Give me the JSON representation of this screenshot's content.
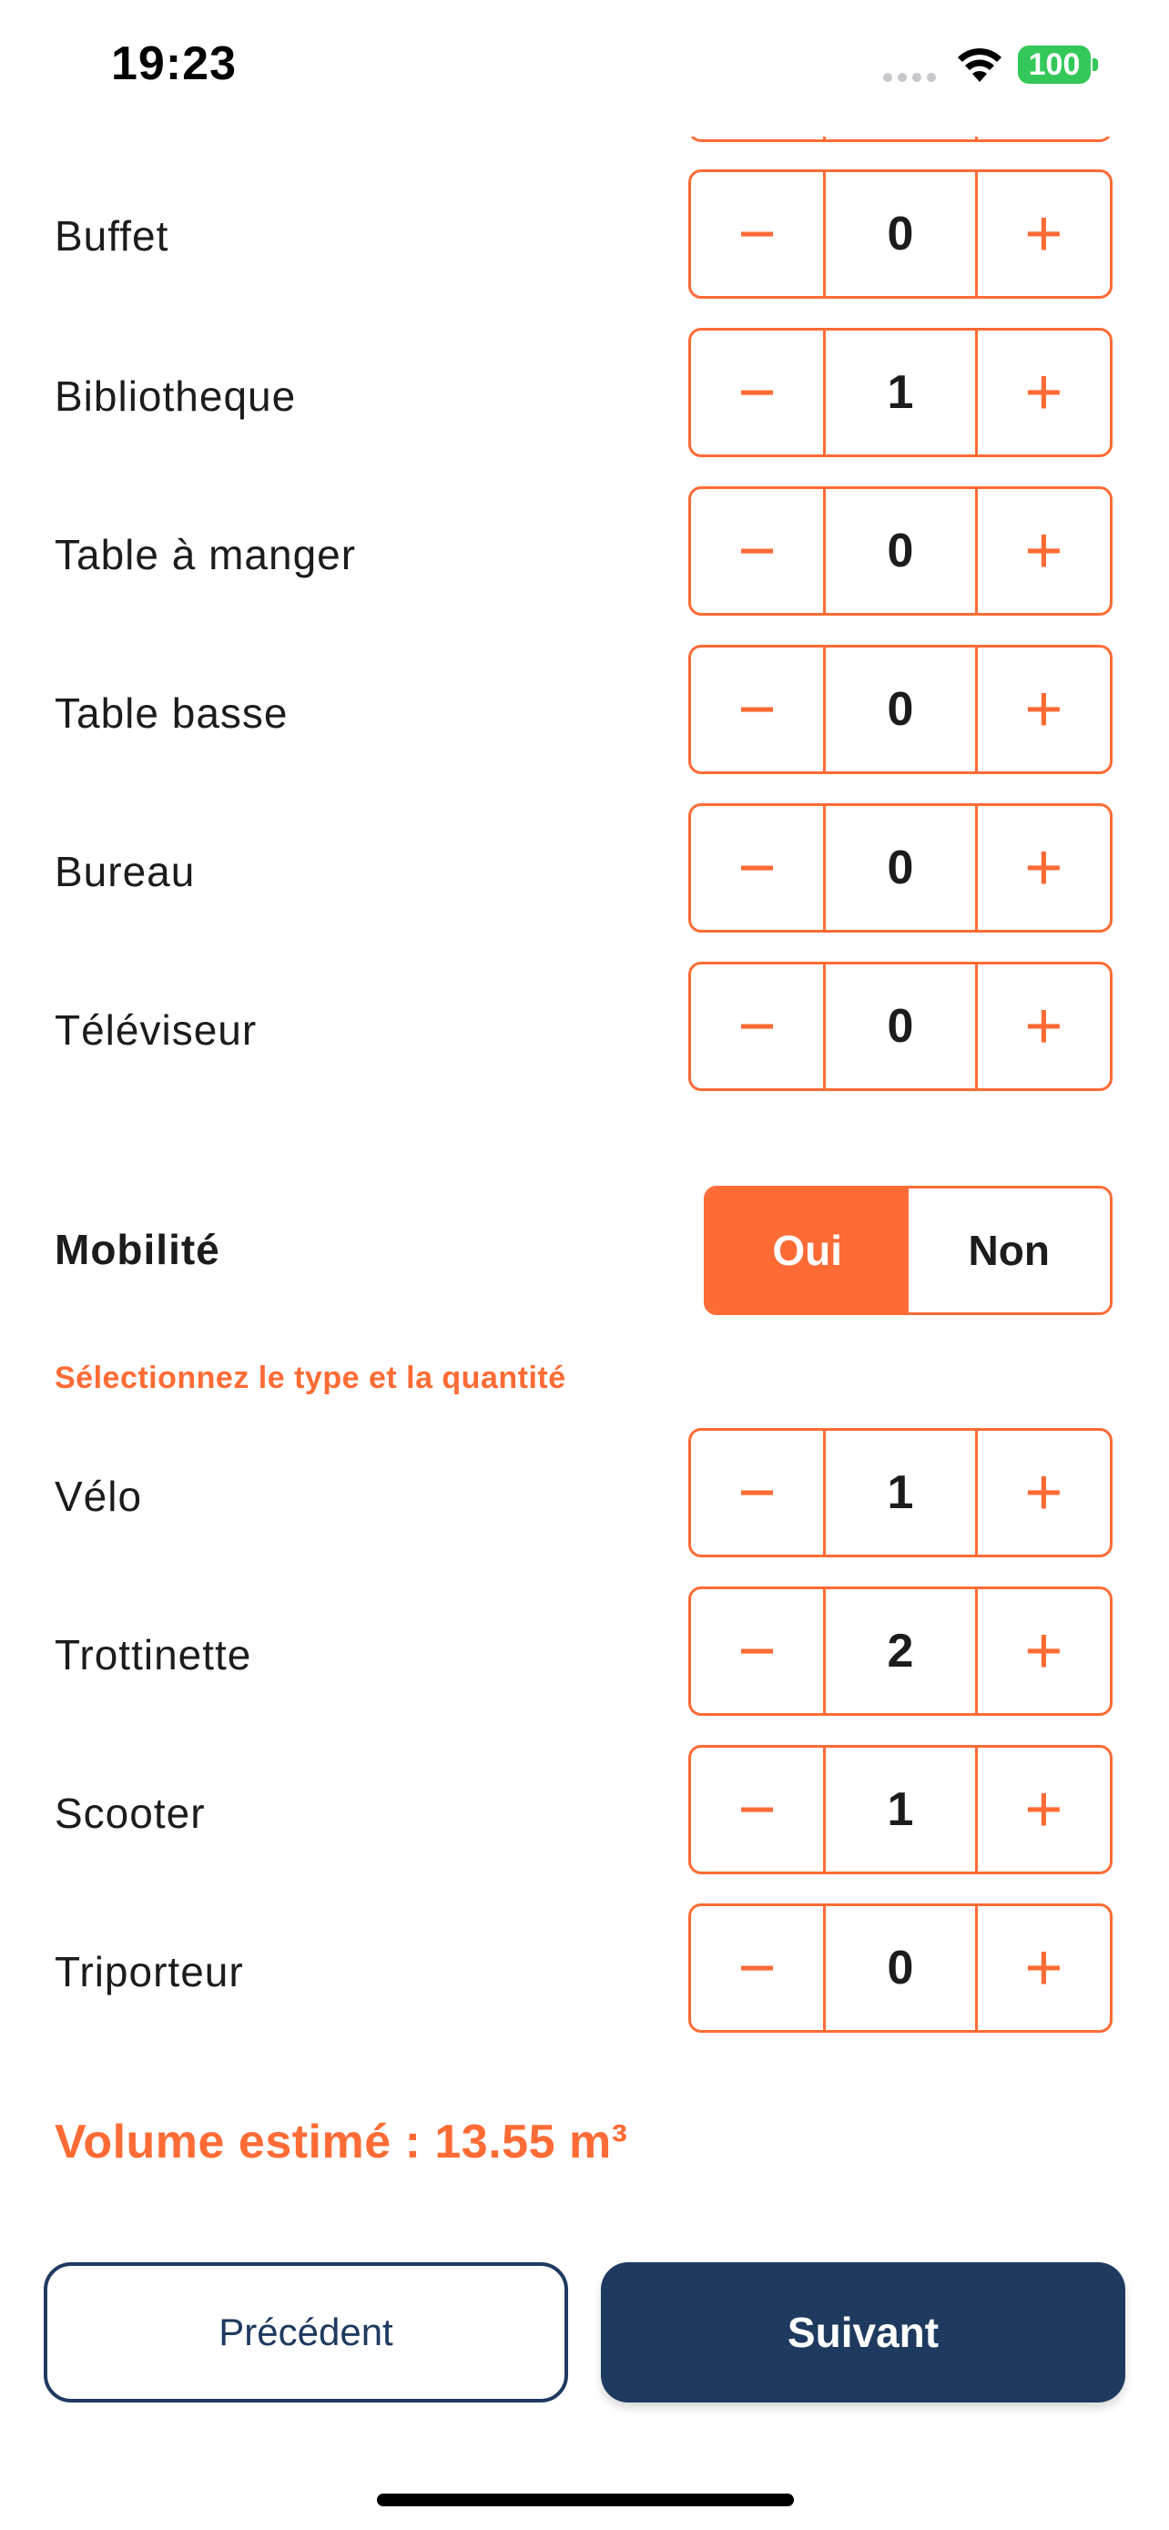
{
  "status": {
    "time": "19:23",
    "battery": "100"
  },
  "furniture": [
    {
      "label": "Buffet",
      "value": "0"
    },
    {
      "label": "Bibliotheque",
      "value": "1"
    },
    {
      "label": "Table à manger",
      "value": "0"
    },
    {
      "label": "Table basse",
      "value": "0"
    },
    {
      "label": "Bureau",
      "value": "0"
    },
    {
      "label": "Téléviseur",
      "value": "0"
    }
  ],
  "mobility": {
    "title": "Mobilité",
    "yes_label": "Oui",
    "no_label": "Non",
    "selected": "Oui",
    "hint": "Sélectionnez le type et la quantité",
    "items": [
      {
        "label": "Vélo",
        "value": "1"
      },
      {
        "label": "Trottinette",
        "value": "2"
      },
      {
        "label": "Scooter",
        "value": "1"
      },
      {
        "label": "Triporteur",
        "value": "0"
      }
    ]
  },
  "stepper": {
    "minus": "−",
    "plus": "+"
  },
  "volume": "Volume estimé : 13.55 m³",
  "nav": {
    "prev_label": "Précédent",
    "next_label": "Suivant"
  },
  "colors": {
    "accent": "#ff6b35",
    "navy": "#1f3a5f",
    "battery": "#34c759"
  },
  "icons": [
    "wifi-icon",
    "battery-icon",
    "signal-icon",
    "minus-icon",
    "plus-icon"
  ]
}
